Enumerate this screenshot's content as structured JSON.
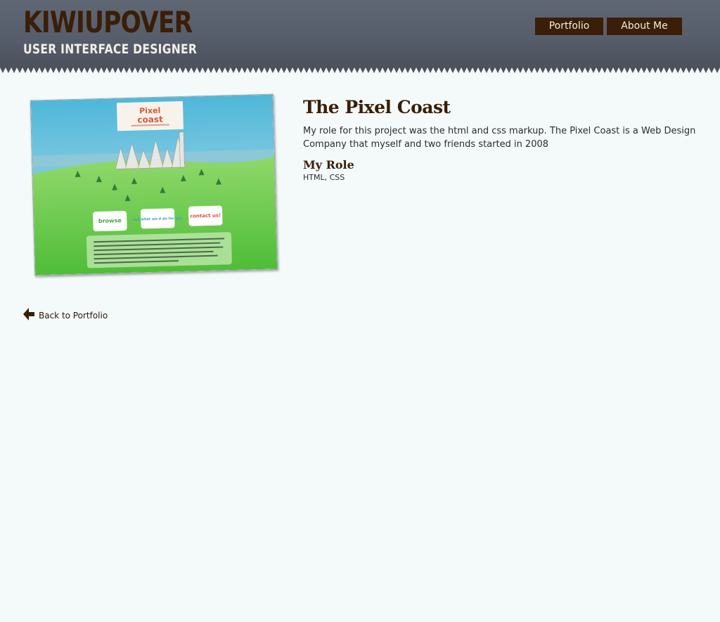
{
  "header": {
    "logo_title": "KIWIUPOVER",
    "logo_subtitle": "USER INTERFACE DESIGNER",
    "nav": {
      "portfolio_label": "Portfolio",
      "about_label": "About Me"
    }
  },
  "project": {
    "title": "The Pixel Coast",
    "description": "My role for this project was the html and css markup. The Pixel Coast is a Web Design Company that myself and two friends started in 2008",
    "role_heading": "My Role",
    "role_text": "HTML, CSS",
    "thumbnail": {
      "logo_line1": "Pixel",
      "logo_line2": "coast",
      "button_browse": "browse",
      "button_what_we_do": "see what we'd do for you",
      "button_contact": "contact us!"
    }
  },
  "back_link": {
    "label": "Back to Portfolio",
    "icon": "arrow-left-icon"
  },
  "colors": {
    "header_bg": "#575e6b",
    "brand_brown": "#3a1e07",
    "page_bg": "#f4f9fa"
  }
}
